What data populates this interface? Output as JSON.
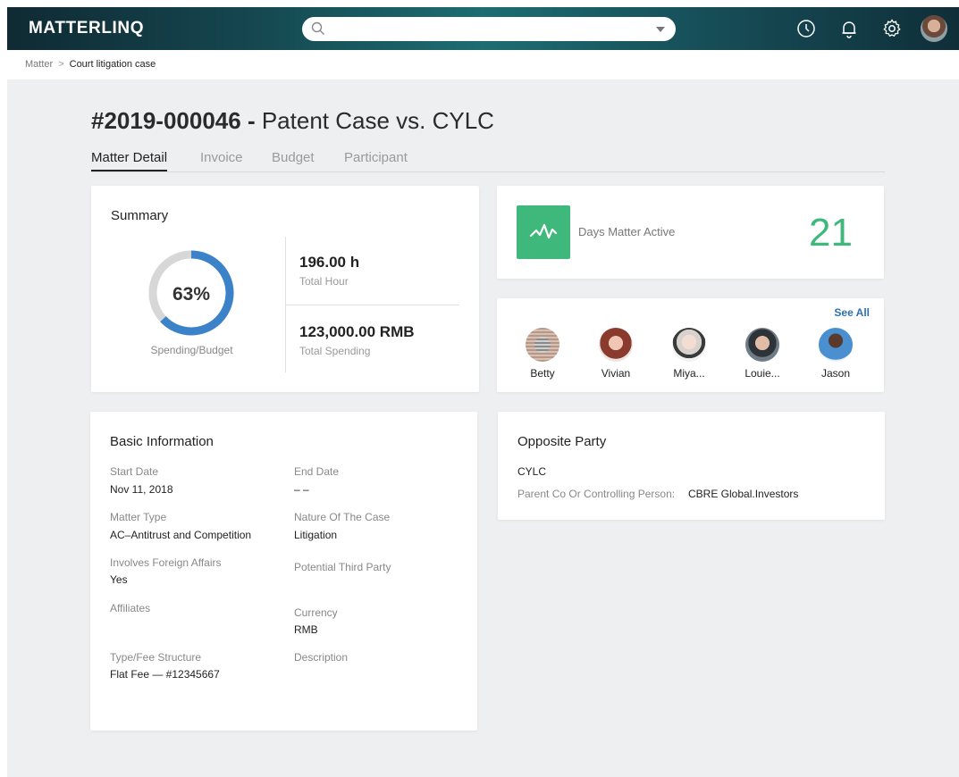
{
  "header": {
    "logo": "MATTERLINQ",
    "search": {
      "value": "",
      "placeholder": ""
    },
    "icons": [
      "clock-icon",
      "bell-icon",
      "gear-icon",
      "user-avatar"
    ]
  },
  "breadcrumb": {
    "parent": "Matter",
    "separator": ">",
    "current": "Court litigation case"
  },
  "page": {
    "title_number": "#2019-000046 -",
    "title_name": "Patent Case vs. CYLC",
    "tabs": [
      "Matter Detail",
      "Invoice",
      "Budget",
      "Participant"
    ],
    "active_tab": "Matter Detail"
  },
  "summary": {
    "title": "Summary",
    "percent_text": "63%",
    "percent_value": 0.63,
    "percent_label": "Spending/Budget",
    "total_hour": "196.00 h",
    "total_hour_label": "Total Hour",
    "total_spending": "123,000.00 RMB",
    "total_spending_label": "Total Spending"
  },
  "days_active": {
    "label": "Days Matter Active",
    "value": "21"
  },
  "participants": {
    "see_all": "See All",
    "people": [
      "Betty",
      "Vivian",
      "Miya...",
      "Louie...",
      "Jason"
    ]
  },
  "basic_info": {
    "title": "Basic Information",
    "start_date_label": "Start Date",
    "start_date": "Nov 11, 2018",
    "end_date_label": "End Date",
    "end_date": "– –",
    "matter_type_label": "Matter Type",
    "matter_type": "AC–Antitrust and Competition",
    "nature_label": "Nature Of The Case",
    "nature": "Litigation",
    "foreign_label": "Involves Foreign Affairs",
    "foreign": "Yes",
    "third_party_label": "Potential Third Party",
    "affiliates_label": "Affiliates",
    "currency_label": "Currency",
    "currency": "RMB",
    "fee_label": "Type/Fee Structure",
    "fee": "Flat Fee — #12345667",
    "description_label": "Description"
  },
  "opposite_party": {
    "title": "Opposite Party",
    "name": "CYLC",
    "parent_label": "Parent Co Or Controlling Person:",
    "parent_value": "CBRE Global.Investors"
  },
  "colors": {
    "accent_green": "#3fb87b",
    "donut_blue": "#3b82c8",
    "link_blue": "#2e6fb3"
  }
}
